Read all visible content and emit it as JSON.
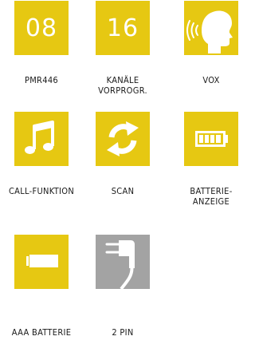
{
  "colors": {
    "tile_yellow": "#e6c812",
    "tile_gray": "#a3a3a3",
    "icon": "#ffffff",
    "label_text": "#1a1a1a"
  },
  "features": [
    {
      "tile_text": "08",
      "label": "PMR446"
    },
    {
      "tile_text": "16",
      "label_lines": [
        "KANÄLE",
        "VORPROGR."
      ]
    },
    {
      "icon": "head-speaking-icon",
      "label": "VOX"
    },
    {
      "icon": "music-note-icon",
      "label": "CALL-FUNKTION"
    },
    {
      "icon": "scan-arrows-icon",
      "label": "SCAN"
    },
    {
      "icon": "battery-full-icon",
      "label_lines": [
        "BATTERIE-",
        "ANZEIGE"
      ]
    },
    {
      "icon": "aaa-battery-icon",
      "label": "AAA BATTERIE"
    },
    {
      "icon": "headset-plug-icon",
      "label": "2 PIN"
    }
  ]
}
